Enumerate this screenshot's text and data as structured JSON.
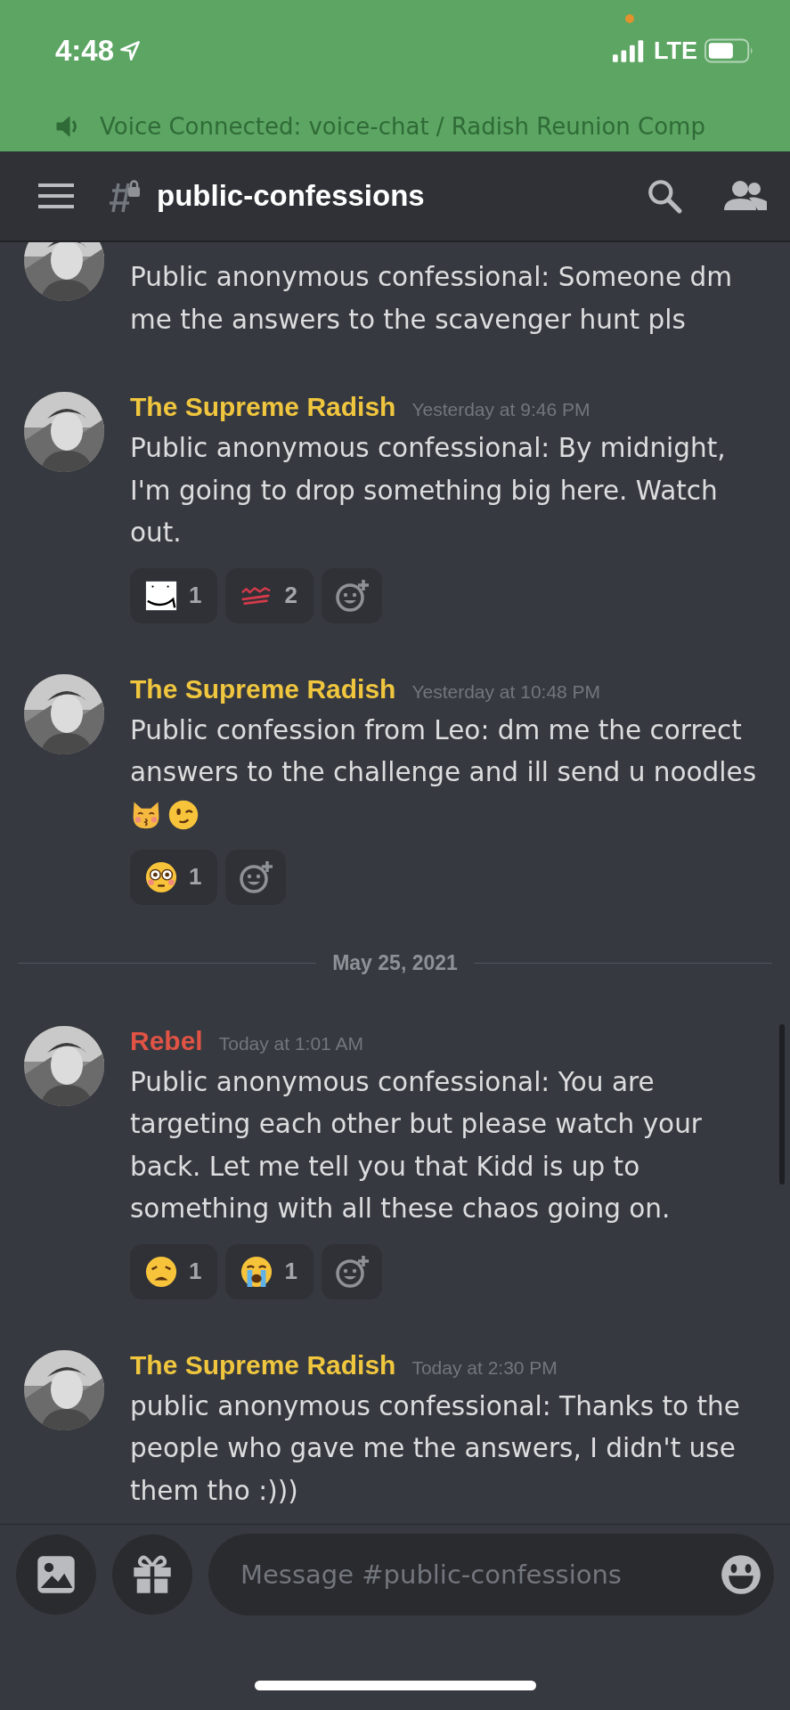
{
  "status_bar": {
    "time": "4:48",
    "network": "LTE"
  },
  "voice_banner": {
    "text": "Voice Connected: voice-chat / Radish Reunion Comp"
  },
  "channel": {
    "name": "public-confessions"
  },
  "messages": [
    {
      "kind": "message",
      "body": "Public anonymous confessional: Someone dm me the answers to the scavenger hunt pls"
    },
    {
      "kind": "message",
      "author": "The Supreme Radish",
      "color": "#f0c63f",
      "time": "Yesterday at 9:46 PM",
      "body": "Public anonymous confessional: By midnight, I'm going to drop something big here. Watch out.",
      "reactions": [
        {
          "kind": "custom-smile",
          "count": "1"
        },
        {
          "kind": "scribble",
          "count": "2"
        }
      ]
    },
    {
      "kind": "message",
      "author": "The Supreme Radish",
      "color": "#f0c63f",
      "time": "Yesterday at 10:48 PM",
      "body": "Public confession from Leo: dm me the correct answers to the challenge and ill send u noodles",
      "emojis": [
        {
          "kind": "kissing-cat"
        },
        {
          "kind": "wink"
        }
      ],
      "reactions": [
        {
          "kind": "flushed",
          "count": "1"
        }
      ]
    },
    {
      "kind": "date-divider",
      "date": "May 25, 2021"
    },
    {
      "kind": "message",
      "author": "Rebel",
      "color": "#e05345",
      "time": "Today at 1:01 AM",
      "body": "Public anonymous confessional: You are targeting each other but please watch your back. Let me tell you that Kidd is up to something with all these chaos going on.",
      "reactions": [
        {
          "kind": "weary",
          "count": "1"
        },
        {
          "kind": "sob",
          "count": "1"
        }
      ]
    },
    {
      "kind": "message",
      "author": "The Supreme Radish",
      "color": "#f0c63f",
      "time": "Today at 2:30 PM",
      "body": "public anonymous confessional: Thanks to the people who gave me the answers, I didn't use them tho :)))"
    }
  ],
  "composer": {
    "placeholder": "Message #public-confessions"
  }
}
